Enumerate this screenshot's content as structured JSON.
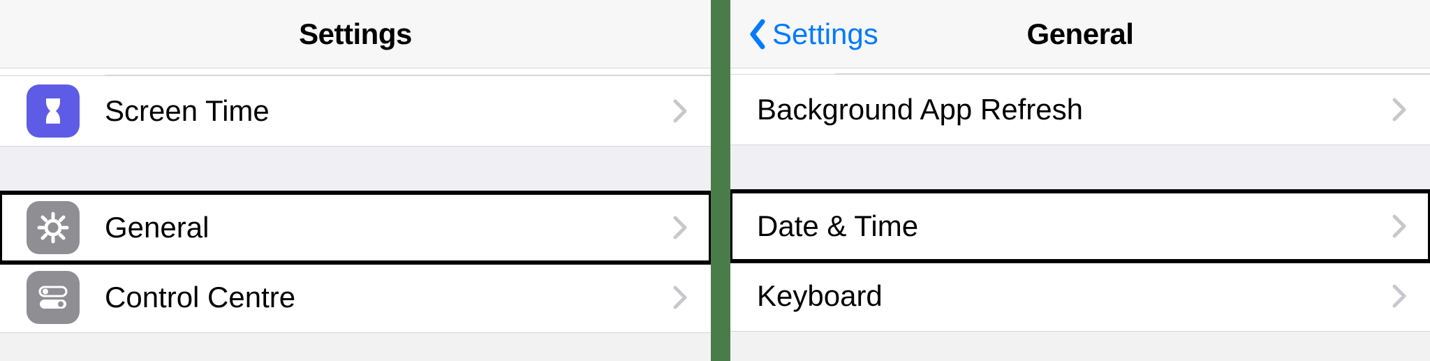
{
  "left": {
    "title": "Settings",
    "rows": {
      "screen_time": "Screen Time",
      "general": "General",
      "control_centre": "Control Centre"
    }
  },
  "right": {
    "title": "General",
    "back_label": "Settings",
    "rows": {
      "background_app_refresh": "Background App Refresh",
      "date_time": "Date & Time",
      "keyboard": "Keyboard"
    }
  }
}
